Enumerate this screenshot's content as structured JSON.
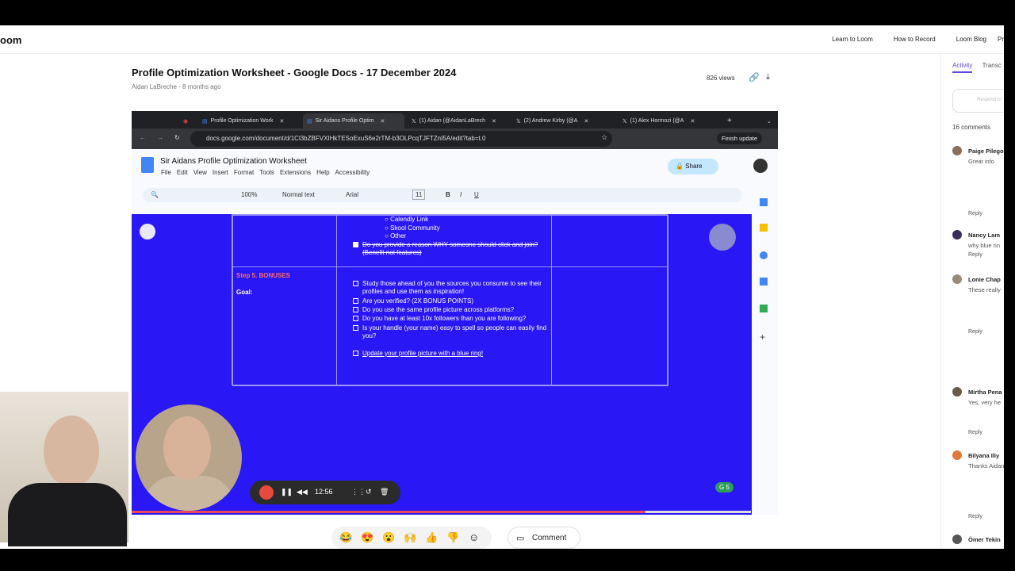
{
  "loom": {
    "brand": "oom",
    "nav": [
      "Learn to Loom",
      "How to Record",
      "Loom Blog",
      "Pr"
    ],
    "video_title": "Profile Optimization Worksheet - Google Docs - 17 December 2024",
    "author": "Aidan LaBreche",
    "age": "8 months ago",
    "views": "826 views"
  },
  "browser": {
    "tabs": [
      {
        "label": "Profile Optimization Work"
      },
      {
        "label": "Sir Aidans Profile Optim"
      },
      {
        "label": "(1) Aidan (@AidanLaBrech"
      },
      {
        "label": "(2) Andrew Kirby (@A"
      },
      {
        "label": "(1) Alex Hormozi (@A"
      }
    ],
    "url": "docs.google.com/document/d/1Cl3bZBFVXIHkTESoExuS6e2rTM-b3OLPcqTJFTZnI5A/edit?tab=t.0",
    "finish_update": "Finish update"
  },
  "gdocs": {
    "title": "Sir Aidans Profile Optimization Worksheet",
    "menu": [
      "File",
      "Edit",
      "View",
      "Insert",
      "Format",
      "Tools",
      "Extensions",
      "Help",
      "Accessibility"
    ],
    "zoom": "100%",
    "style": "Normal text",
    "font": "Arial",
    "font_size": "11",
    "share": "Share"
  },
  "doc": {
    "bullets": [
      "Calendly Link",
      "Skool Community",
      "Other"
    ],
    "prev_item": "Do you provide a reason WHY someone should click and join? (Benefit not features)",
    "step_label": "Step 5. BONUSES",
    "goal_label": "Goal:",
    "items": [
      "Study those ahead of you the sources you consume to see their profiles and use them as inspiration!",
      "Are you verified? (2X BONUS POINTS)",
      "Do you use the same profile picture across platforms?",
      "Do you have at least 10x followers than you are following?",
      "Is your handle (your name) easy to spell so people can easily find you?",
      "Update your profile picture with a blue ring!"
    ]
  },
  "recorder": {
    "time": "12:56",
    "progress": 0.83
  },
  "reactions": {
    "emojis": [
      "😂",
      "😍",
      "😮",
      "🙌",
      "👍",
      "👎",
      "☺"
    ],
    "comment": "Comment"
  },
  "activity": {
    "tab_active": "Activity",
    "tab_other": "Transc",
    "respond": "Respond to",
    "count": "16 comments",
    "comments": [
      {
        "name": "Paige Pilego",
        "text": "Great info",
        "reply": "Reply"
      },
      {
        "name": "Nancy Lam",
        "text": "why blue rin",
        "reply": "Reply"
      },
      {
        "name": "Lonie Chap",
        "text": "These really",
        "reply": "Reply"
      },
      {
        "name": "Mirtha Pena",
        "text": "Yes, very he",
        "reply": "Reply"
      },
      {
        "name": "Bilyana Iliy",
        "text": "Thanks Aidan",
        "reply": "Reply"
      },
      {
        "name": "Ömer Tekin",
        "text": "",
        "reply": ""
      }
    ]
  }
}
